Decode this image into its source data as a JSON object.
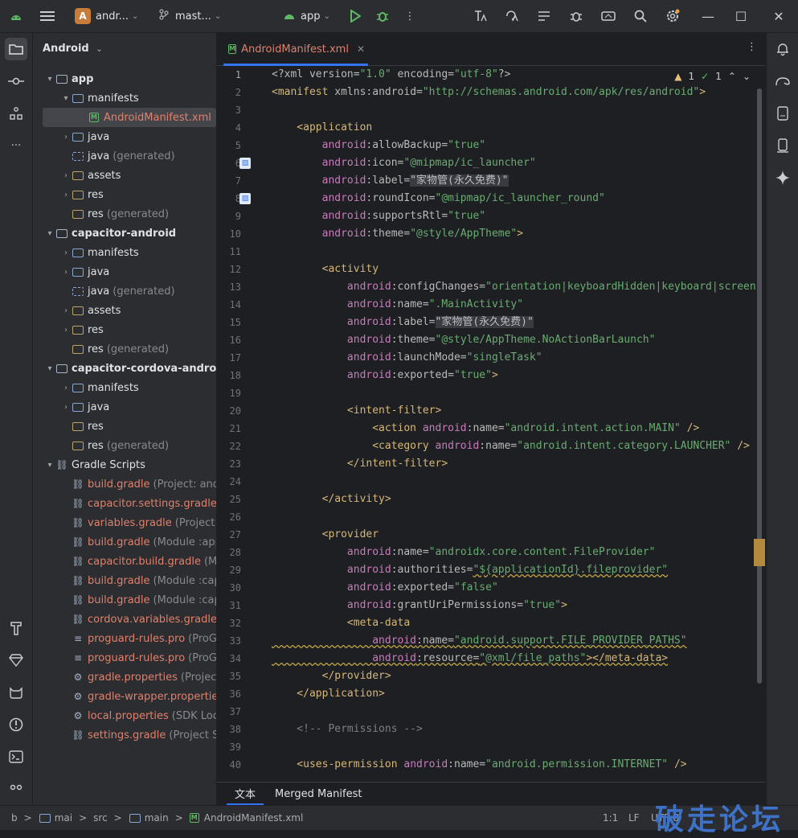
{
  "titlebar": {
    "project_badge": "A",
    "project_name": "andr...",
    "branch": "mast...",
    "run_config": "app",
    "icons": [
      "android-icon",
      "hamburger-menu-icon",
      "branch-icon",
      "run-icon",
      "debug-icon",
      "more-vertical-icon",
      "translate-icon",
      "translate-icon",
      "list-icon",
      "bug-icon",
      "device-sync-icon",
      "search-icon",
      "settings-gear-icon"
    ],
    "window": {
      "minimize": "—",
      "maximize": "☐",
      "close": "✕"
    }
  },
  "project_panel": {
    "title": "Android",
    "tree": [
      {
        "indent": 0,
        "arrow": "▾",
        "icon": "module",
        "label": "app",
        "bold": true
      },
      {
        "indent": 1,
        "arrow": "▾",
        "icon": "folder",
        "label": "manifests"
      },
      {
        "indent": 2,
        "arrow": "",
        "icon": "xml",
        "label": "AndroidManifest.xml",
        "orange": true,
        "selected": true
      },
      {
        "indent": 1,
        "arrow": "›",
        "icon": "folder",
        "label": "java"
      },
      {
        "indent": 1,
        "arrow": "",
        "icon": "folder-gen",
        "label": "java",
        "suffix": "(generated)"
      },
      {
        "indent": 1,
        "arrow": "›",
        "icon": "folder-res",
        "label": "assets"
      },
      {
        "indent": 1,
        "arrow": "›",
        "icon": "folder-res",
        "label": "res"
      },
      {
        "indent": 1,
        "arrow": "",
        "icon": "folder-res",
        "label": "res",
        "suffix": "(generated)"
      },
      {
        "indent": 0,
        "arrow": "▾",
        "icon": "module",
        "label": "capacitor-android",
        "bold": true
      },
      {
        "indent": 1,
        "arrow": "›",
        "icon": "folder",
        "label": "manifests"
      },
      {
        "indent": 1,
        "arrow": "›",
        "icon": "folder",
        "label": "java"
      },
      {
        "indent": 1,
        "arrow": "",
        "icon": "folder-gen",
        "label": "java",
        "suffix": "(generated)"
      },
      {
        "indent": 1,
        "arrow": "›",
        "icon": "folder-res",
        "label": "assets"
      },
      {
        "indent": 1,
        "arrow": "›",
        "icon": "folder-res",
        "label": "res"
      },
      {
        "indent": 1,
        "arrow": "",
        "icon": "folder-res",
        "label": "res",
        "suffix": "(generated)"
      },
      {
        "indent": 0,
        "arrow": "▾",
        "icon": "module",
        "label": "capacitor-cordova-android-p",
        "bold": true
      },
      {
        "indent": 1,
        "arrow": "›",
        "icon": "folder",
        "label": "manifests"
      },
      {
        "indent": 1,
        "arrow": "›",
        "icon": "folder",
        "label": "java"
      },
      {
        "indent": 1,
        "arrow": "",
        "icon": "folder-res",
        "label": "res"
      },
      {
        "indent": 1,
        "arrow": "",
        "icon": "folder-res",
        "label": "res",
        "suffix": "(generated)"
      },
      {
        "indent": 0,
        "arrow": "▾",
        "icon": "gradle",
        "label": "Gradle Scripts"
      },
      {
        "indent": 1,
        "arrow": "",
        "icon": "gradle",
        "label": "build.gradle",
        "suffix": "(Project: andro",
        "orange": true
      },
      {
        "indent": 1,
        "arrow": "",
        "icon": "gradle",
        "label": "capacitor.settings.gradle",
        "suffix": "(P",
        "orange": true
      },
      {
        "indent": 1,
        "arrow": "",
        "icon": "gradle",
        "label": "variables.gradle",
        "suffix": "(Project: ar",
        "orange": true
      },
      {
        "indent": 1,
        "arrow": "",
        "icon": "gradle",
        "label": "build.gradle",
        "suffix": "(Module :app)",
        "orange": true
      },
      {
        "indent": 1,
        "arrow": "",
        "icon": "gradle",
        "label": "capacitor.build.gradle",
        "suffix": "(Mo",
        "orange": true
      },
      {
        "indent": 1,
        "arrow": "",
        "icon": "gradle",
        "label": "build.gradle",
        "suffix": "(Module :capa",
        "orange": true
      },
      {
        "indent": 1,
        "arrow": "",
        "icon": "gradle",
        "label": "build.gradle",
        "suffix": "(Module :capa",
        "orange": true
      },
      {
        "indent": 1,
        "arrow": "",
        "icon": "gradle",
        "label": "cordova.variables.gradle",
        "suffix": "(M",
        "orange": true
      },
      {
        "indent": 1,
        "arrow": "",
        "icon": "lines",
        "label": "proguard-rules.pro",
        "suffix": "(ProGu",
        "orange": true
      },
      {
        "indent": 1,
        "arrow": "",
        "icon": "lines",
        "label": "proguard-rules.pro",
        "suffix": "(ProGu",
        "orange": true
      },
      {
        "indent": 1,
        "arrow": "",
        "icon": "gear",
        "label": "gradle.properties",
        "suffix": "(Project P",
        "orange": true
      },
      {
        "indent": 1,
        "arrow": "",
        "icon": "gear",
        "label": "gradle-wrapper.properties",
        "orange": true
      },
      {
        "indent": 1,
        "arrow": "",
        "icon": "gear",
        "label": "local.properties",
        "suffix": "(SDK Locat",
        "orange": true
      },
      {
        "indent": 1,
        "arrow": "",
        "icon": "gradle",
        "label": "settings.gradle",
        "suffix": "(Project Set",
        "orange": true
      }
    ]
  },
  "editor": {
    "tab_label": "AndroidManifest.xml",
    "inspections": {
      "warnings": "1",
      "checks": "1"
    },
    "line_numbers": [
      "1",
      "2",
      "3",
      "4",
      "5",
      "6",
      "7",
      "8",
      "9",
      "10",
      "11",
      "12",
      "13",
      "14",
      "15",
      "16",
      "17",
      "18",
      "19",
      "20",
      "21",
      "22",
      "23",
      "24",
      "25",
      "26",
      "27",
      "28",
      "29",
      "30",
      "31",
      "32",
      "33",
      "34",
      "35",
      "36",
      "37",
      "38",
      "39",
      "40"
    ],
    "lines": [
      [
        [
          "t-attr",
          "<?xml version="
        ],
        [
          "t-val",
          "\"1.0\""
        ],
        [
          "t-attr",
          " encoding="
        ],
        [
          "t-val",
          "\"utf-8\""
        ],
        [
          "t-attr",
          "?>"
        ]
      ],
      [
        [
          "t-tag",
          "<manifest "
        ],
        [
          "t-attr",
          "xmlns:android="
        ],
        [
          "t-val",
          "\"http://schemas.android.com/apk/res/android\""
        ],
        [
          "t-tag",
          ">"
        ]
      ],
      [],
      [
        [
          "t-tag",
          "    <application"
        ]
      ],
      [
        [
          "t-ns",
          "        android"
        ],
        [
          "t-attr",
          ":allowBackup="
        ],
        [
          "t-val",
          "\"true\""
        ]
      ],
      [
        [
          "t-ns",
          "        android"
        ],
        [
          "t-attr",
          ":icon="
        ],
        [
          "t-val",
          "\"@mipmap/ic_launcher\""
        ]
      ],
      [
        [
          "t-ns",
          "        android"
        ],
        [
          "t-attr",
          ":label="
        ],
        [
          "t-hl",
          "\"家物管(永久免费)\""
        ]
      ],
      [
        [
          "t-ns",
          "        android"
        ],
        [
          "t-attr",
          ":roundIcon="
        ],
        [
          "t-val",
          "\"@mipmap/ic_launcher_round\""
        ]
      ],
      [
        [
          "t-ns",
          "        android"
        ],
        [
          "t-attr",
          ":supportsRtl="
        ],
        [
          "t-val",
          "\"true\""
        ]
      ],
      [
        [
          "t-ns",
          "        android"
        ],
        [
          "t-attr",
          ":theme="
        ],
        [
          "t-val",
          "\"@style/AppTheme\""
        ],
        [
          "t-tag",
          ">"
        ]
      ],
      [],
      [
        [
          "t-tag",
          "        <activity"
        ]
      ],
      [
        [
          "t-ns",
          "            android"
        ],
        [
          "t-attr",
          ":configChanges="
        ],
        [
          "t-val",
          "\"orientation|keyboardHidden|keyboard|screen"
        ]
      ],
      [
        [
          "t-ns",
          "            android"
        ],
        [
          "t-attr",
          ":name="
        ],
        [
          "t-val",
          "\".MainActivity\""
        ]
      ],
      [
        [
          "t-ns",
          "            android"
        ],
        [
          "t-attr",
          ":label="
        ],
        [
          "t-hl",
          "\"家物管(永久免费)\""
        ]
      ],
      [
        [
          "t-ns",
          "            android"
        ],
        [
          "t-attr",
          ":theme="
        ],
        [
          "t-val",
          "\"@style/AppTheme.NoActionBarLaunch\""
        ]
      ],
      [
        [
          "t-ns",
          "            android"
        ],
        [
          "t-attr",
          ":launchMode="
        ],
        [
          "t-val",
          "\"singleTask\""
        ]
      ],
      [
        [
          "t-ns",
          "            android"
        ],
        [
          "t-attr",
          ":exported="
        ],
        [
          "t-val",
          "\"true\""
        ],
        [
          "t-tag",
          ">"
        ]
      ],
      [],
      [
        [
          "t-tag",
          "            <intent-filter>"
        ]
      ],
      [
        [
          "t-tag",
          "                <action "
        ],
        [
          "t-ns",
          "android"
        ],
        [
          "t-attr",
          ":name="
        ],
        [
          "t-val",
          "\"android.intent.action.MAIN\""
        ],
        [
          "t-tag",
          " />"
        ]
      ],
      [
        [
          "t-tag",
          "                <category "
        ],
        [
          "t-ns",
          "android"
        ],
        [
          "t-attr",
          ":name="
        ],
        [
          "t-val",
          "\"android.intent.category.LAUNCHER\""
        ],
        [
          "t-tag",
          " />"
        ]
      ],
      [
        [
          "t-tag",
          "            </intent-filter>"
        ]
      ],
      [],
      [
        [
          "t-tag",
          "        </activity>"
        ]
      ],
      [],
      [
        [
          "t-tag",
          "        <provider"
        ]
      ],
      [
        [
          "t-ns",
          "            android"
        ],
        [
          "t-attr",
          ":name="
        ],
        [
          "t-val",
          "\"androidx.core.content.FileProvider\""
        ]
      ],
      [
        [
          "t-ns",
          "            android"
        ],
        [
          "t-attr",
          ":authorities="
        ],
        [
          "t-val",
          "\"${applicationId}.fileprovider\""
        ]
      ],
      [
        [
          "t-ns",
          "            android"
        ],
        [
          "t-attr",
          ":exported="
        ],
        [
          "t-val",
          "\"false\""
        ]
      ],
      [
        [
          "t-ns",
          "            android"
        ],
        [
          "t-attr",
          ":grantUriPermissions="
        ],
        [
          "t-val",
          "\"true\""
        ],
        [
          "t-tag",
          ">"
        ]
      ],
      [
        [
          "t-tag",
          "            <meta-data"
        ]
      ],
      [
        [
          "t-ns",
          "                android"
        ],
        [
          "t-attr",
          ":name="
        ],
        [
          "t-val",
          "\"android.support.FILE_PROVIDER_PATHS\""
        ]
      ],
      [
        [
          "t-ns",
          "                android"
        ],
        [
          "t-attr",
          ":resource="
        ],
        [
          "t-val",
          "\"@xml/file_paths\""
        ],
        [
          "t-tag",
          "></meta-data>"
        ]
      ],
      [
        [
          "t-tag",
          "        </provider>"
        ]
      ],
      [
        [
          "t-tag",
          "    </application>"
        ]
      ],
      [],
      [
        [
          "t-cmt",
          "    <!-- Permissions -->"
        ]
      ],
      [],
      [
        [
          "t-tag",
          "    <uses-permission "
        ],
        [
          "t-ns",
          "android"
        ],
        [
          "t-attr",
          ":name="
        ],
        [
          "t-val",
          "\"android.permission.INTERNET\""
        ],
        [
          "t-tag",
          " />"
        ]
      ]
    ],
    "bottom_tabs": [
      "文本",
      "Merged Manifest"
    ]
  },
  "right_strip_icons": [
    "notifications-icon",
    "gradle-sync-icon",
    "device-manager-icon",
    "running-devices-icon",
    "gemini-sparkle-icon"
  ],
  "left_strip_icons": [
    "project-folder-icon",
    "commit-icon",
    "structure-icon",
    "more-icon",
    "build-hammer-icon",
    "resource-gem-icon",
    "android-cat-icon",
    "problems-icon",
    "terminal-icon",
    "services-icon"
  ],
  "statusbar": {
    "breadcrumb": [
      "b",
      ">",
      "mai",
      ">",
      "src",
      ">",
      "main",
      ">",
      "AndroidManifest.xml"
    ],
    "breadcrumb_src": "src",
    "position": "1:1",
    "line_sep": "LF",
    "encoding": "UTF-8",
    "watermark": "破走论坛"
  }
}
